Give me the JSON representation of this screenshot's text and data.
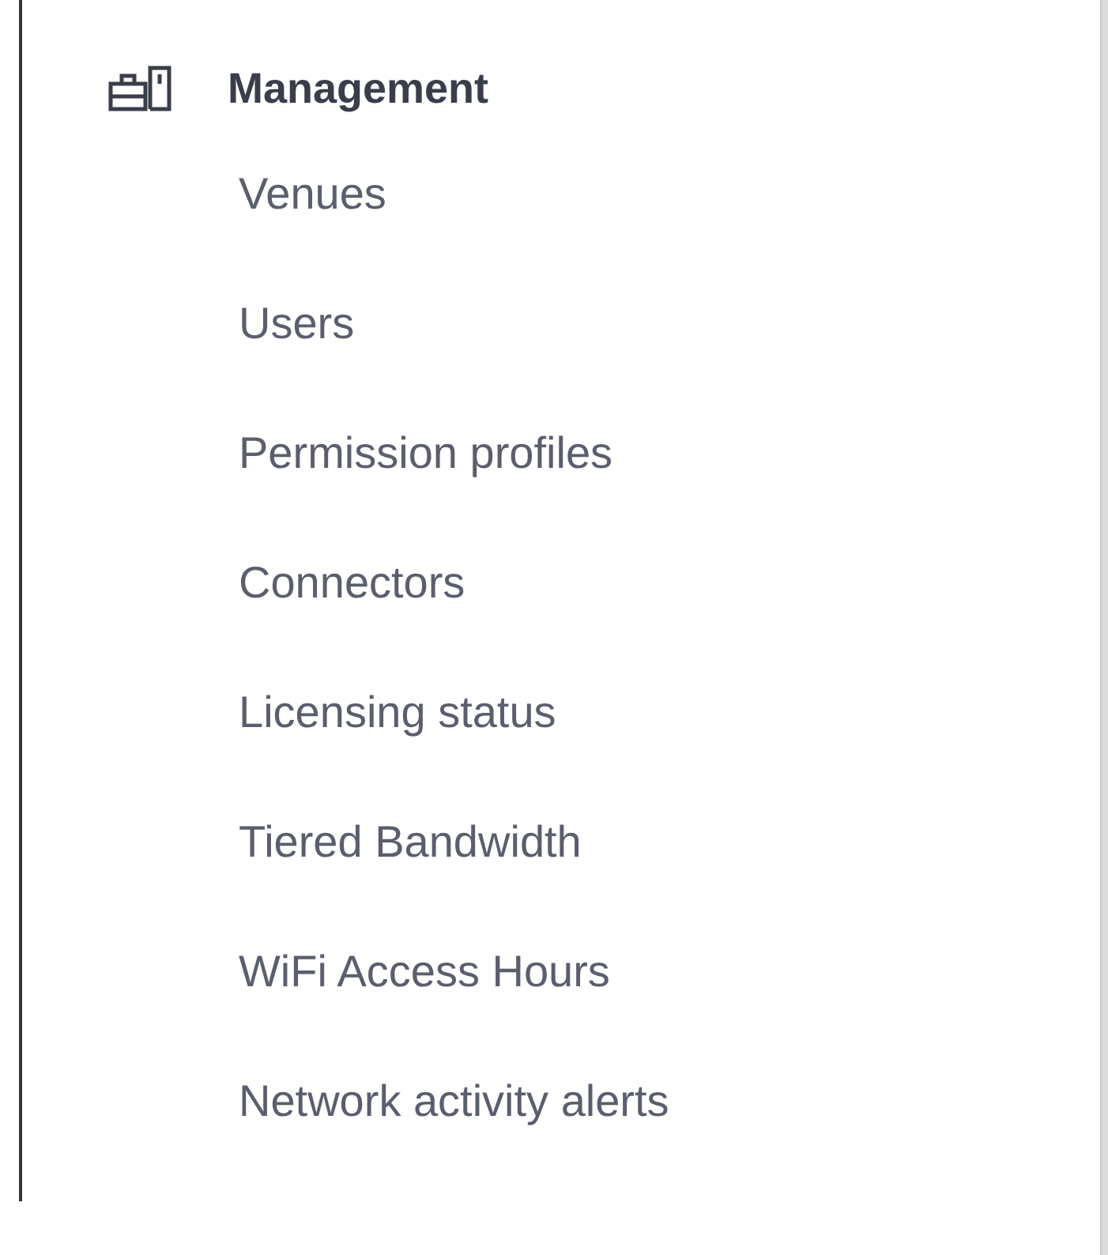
{
  "section": {
    "title": "Management",
    "items": [
      {
        "label": "Venues"
      },
      {
        "label": "Users"
      },
      {
        "label": "Permission profiles"
      },
      {
        "label": "Connectors"
      },
      {
        "label": "Licensing status"
      },
      {
        "label": "Tiered Bandwidth"
      },
      {
        "label": "WiFi Access Hours"
      },
      {
        "label": "Network activity alerts"
      }
    ]
  }
}
